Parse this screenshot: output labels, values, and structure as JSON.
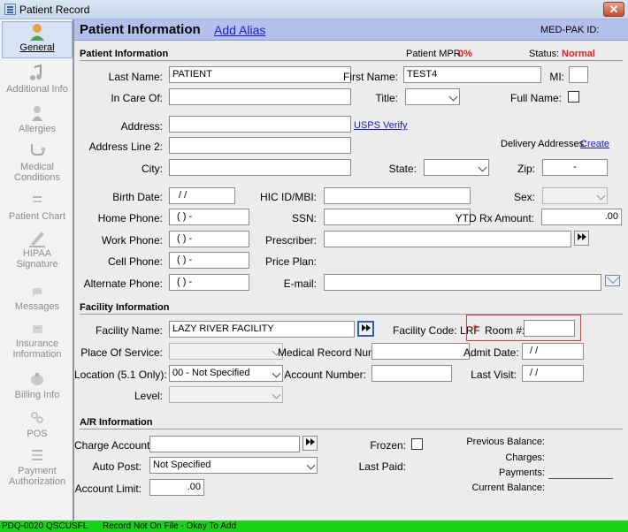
{
  "window": {
    "title": "Patient Record",
    "close_glyph": "✕"
  },
  "sidebar": {
    "items": [
      {
        "label": "General",
        "icon": "person-icon"
      },
      {
        "label": "Additional Info",
        "icon": "musical-note-icon"
      },
      {
        "label": "Allergies",
        "icon": "allergy-icon"
      },
      {
        "label": "Medical Conditions",
        "icon": "stethoscope-icon"
      },
      {
        "label": "Patient Chart",
        "icon": "chart-icon"
      },
      {
        "label": "HIPAA Signature",
        "icon": "pen-icon"
      },
      {
        "label": "Messages",
        "icon": "messages-icon"
      },
      {
        "label": "Insurance Information",
        "icon": "insurance-icon"
      },
      {
        "label": "Billing Info",
        "icon": "billing-icon"
      },
      {
        "label": "POS",
        "icon": "pos-icon"
      },
      {
        "label": "Payment Authorization",
        "icon": "payment-icon"
      }
    ]
  },
  "header": {
    "title": "Patient Information",
    "add_alias": "Add Alias",
    "medpak_label": "MED-PAK ID:"
  },
  "patient": {
    "section_title": "Patient Information",
    "mpr_label": "Patient MPR:",
    "mpr_value": "0%",
    "status_label": "Status:",
    "status_value": "Normal",
    "last_name_label": "Last Name:",
    "last_name": "PATIENT",
    "first_name_label": "First Name:",
    "first_name": "TEST4",
    "mi_label": "MI:",
    "mi": "",
    "in_care_of_label": "In Care Of:",
    "in_care_of": "",
    "title_label": "Title:",
    "title": "",
    "full_name_label": "Full Name:",
    "address_label": "Address:",
    "address": "",
    "usps_verify": "USPS Verify",
    "address2_label": "Address Line 2:",
    "address2": "",
    "delivery_label": "Delivery Addresses:",
    "delivery_create": "Create",
    "city_label": "City:",
    "city": "",
    "state_label": "State:",
    "state": "",
    "zip_label": "Zip:",
    "zip": "-",
    "birth_date_label": "Birth Date:",
    "birth_date": "/ /",
    "hic_label": "HIC ID/MBI:",
    "hic": "",
    "sex_label": "Sex:",
    "sex": "",
    "home_phone_label": "Home Phone:",
    "home_phone": "(  )   -",
    "ssn_label": "SSN:",
    "ssn": "",
    "ytd_label": "YTD Rx Amount:",
    "ytd": ".00",
    "work_phone_label": "Work Phone:",
    "work_phone": "(  )   -",
    "prescriber_label": "Prescriber:",
    "prescriber": "",
    "cell_phone_label": "Cell Phone:",
    "cell_phone": "(  )   -",
    "price_plan_label": "Price Plan:",
    "alt_phone_label": "Alternate Phone:",
    "alt_phone": "(  )   -",
    "email_label": "E-mail:",
    "email": ""
  },
  "facility": {
    "section_title": "Facility Information",
    "name_label": "Facility Name:",
    "name": "LAZY RIVER FACILITY",
    "code_label": "Facility Code: LRF",
    "required_mark": "*",
    "room_label": "Room #:",
    "room": "",
    "pos_label": "Place Of Service:",
    "pos": "",
    "mrn_label": "Medical Record Num:",
    "mrn": "",
    "admit_label": "Admit Date:",
    "admit": "/ /",
    "location_label": "Location (5.1 Only):",
    "location": "00 - Not Specified",
    "account_label": "Account Number:",
    "account": "",
    "last_visit_label": "Last Visit:",
    "last_visit": "/ /",
    "level_label": "Level:",
    "level": ""
  },
  "ar": {
    "section_title": "A/R Information",
    "charge_label": "Charge Account:",
    "charge": "",
    "frozen_label": "Frozen:",
    "prev_balance_label": "Previous Balance:",
    "charges_label": "Charges:",
    "auto_post_label": "Auto Post:",
    "auto_post": "Not Specified",
    "last_paid_label": "Last Paid:",
    "payments_label": "Payments:",
    "account_limit_label": "Account Limit:",
    "account_limit": ".00",
    "current_balance_label": "Current Balance:"
  },
  "status_bar": {
    "left": "PDQ-0020 QSCUSFL",
    "message": "Record Not On File - Okay To Add"
  }
}
